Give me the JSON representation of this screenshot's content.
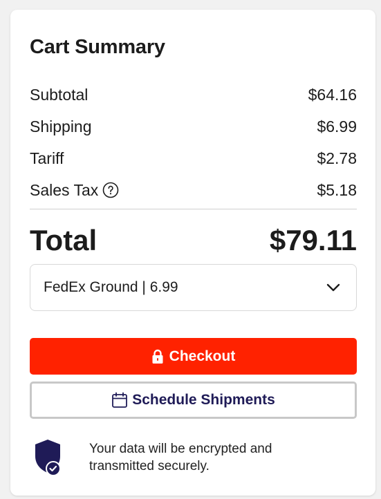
{
  "cart": {
    "title": "Cart Summary",
    "rows": [
      {
        "label": "Subtotal",
        "value": "$64.16"
      },
      {
        "label": "Shipping",
        "value": "$6.99"
      },
      {
        "label": "Tariff",
        "value": "$2.78"
      },
      {
        "label": "Sales Tax",
        "value": "$5.18",
        "icon": "help-circle-icon"
      }
    ],
    "total_label": "Total",
    "total_value": "$79.11"
  },
  "shipping_select": {
    "selected": "FedEx Ground | 6.99",
    "icon": "chevron-down-icon"
  },
  "buttons": {
    "checkout_label": "Checkout",
    "checkout_icon": "lock-icon",
    "schedule_label": "Schedule Shipments",
    "schedule_icon": "calendar-icon"
  },
  "security": {
    "message": "Your data will be encrypted and transmitted securely.",
    "icon": "shield-check-icon"
  },
  "colors": {
    "checkout_bg": "#ff2200",
    "accent_navy": "#1f1b57",
    "text": "#1c1c1c"
  }
}
